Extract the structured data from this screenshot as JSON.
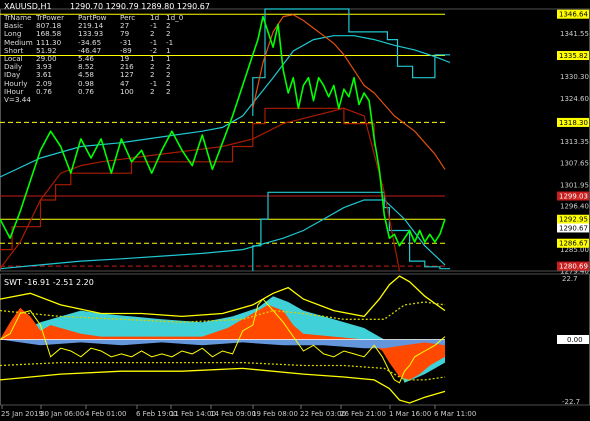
{
  "main_header": {
    "symbol": "XAUUSD,H1",
    "ohlc": "1290.70 1290.79 1289.80 1290.67"
  },
  "stats_table": {
    "columns": [
      "TrName",
      "TrPower",
      "PartPow",
      "Perc",
      "1d",
      "1d_0"
    ],
    "rows": [
      [
        "Basic",
        "807.18",
        "219.14",
        "27",
        "-1",
        "2"
      ],
      [
        "Long",
        "168.58",
        "133.93",
        "79",
        "2",
        "2"
      ],
      [
        "Medium",
        "111.30",
        "-34.65",
        "-31",
        "-1",
        "-1"
      ],
      [
        "Short",
        "51.92",
        "-46.47",
        "-89",
        "-2",
        "1"
      ],
      [
        "Local",
        "29.00",
        "5.46",
        "19",
        "1",
        "1"
      ],
      [
        "Daily",
        "3.93",
        "8.52",
        "216",
        "2",
        "2"
      ],
      [
        "IDay",
        "3.61",
        "4.58",
        "127",
        "2",
        "2"
      ],
      [
        "Hourly",
        "2.09",
        "0.98",
        "47",
        "-1",
        "2"
      ],
      [
        "IHour",
        "0.76",
        "0.76",
        "100",
        "2",
        "2"
      ]
    ],
    "footer": "V=3.44"
  },
  "colors": {
    "background": "#000000",
    "price": "#00ff00",
    "cyan": "#1fc8d2",
    "orange_line": "#e05010",
    "dark_red": "#aa1c00",
    "yellow": "#ffff00",
    "red_level": "#c81e1e",
    "swt_cyan_fill": "#40d0d8",
    "swt_orange_fill": "#ff4800",
    "swt_blue_fill": "#6496dc"
  },
  "chart_data": [
    {
      "type": "line",
      "title": "XAUUSD,H1",
      "yticks": [
        "1346.64",
        "1341.55",
        "1335.82",
        "1330.30",
        "1324.60",
        "1318.30",
        "1313.35",
        "1307.65",
        "1301.95",
        "1299.03",
        "1296.40",
        "1292.95",
        "1290.67",
        "1286.67",
        "1285.00",
        "1280.69",
        "1279.40"
      ],
      "ylim": [
        1279.4,
        1348.0
      ],
      "xticks": [
        "25 Jan 2019",
        "30 Jan 06:00",
        "4 Feb 01:00",
        "6 Feb 19:00",
        "11 Feb 14:00",
        "14 Feb 09:00",
        "19 Feb 08:00",
        "22 Feb 03:00",
        "26 Feb 21:00",
        "1 Mar 16:00",
        "6 Mar 11:00"
      ],
      "price_labels": [
        {
          "text": "1346.64",
          "value": 1346.64,
          "bg": "#ffff00",
          "fg": "#000000"
        },
        {
          "text": "1335.82",
          "value": 1335.82,
          "bg": "#ffff00",
          "fg": "#000000"
        },
        {
          "text": "1318.30",
          "value": 1318.3,
          "bg": "#ffff00",
          "fg": "#000000"
        },
        {
          "text": "1299.03",
          "value": 1299.03,
          "bg": "#c81e1e",
          "fg": "#ffffff"
        },
        {
          "text": "1292.95",
          "value": 1292.95,
          "bg": "#ffff00",
          "fg": "#000000"
        },
        {
          "text": "1290.67",
          "value": 1290.67,
          "bg": "#ffffff",
          "fg": "#000000"
        },
        {
          "text": "1286.67",
          "value": 1286.67,
          "bg": "#ffff00",
          "fg": "#000000"
        },
        {
          "text": "1280.69",
          "value": 1280.69,
          "bg": "#c81e1e",
          "fg": "#ffffff"
        }
      ],
      "horizontal_levels": [
        {
          "value": 1346.64,
          "color": "#ffff00",
          "dashed": false
        },
        {
          "value": 1335.82,
          "color": "#ffff00",
          "dashed": false
        },
        {
          "value": 1318.3,
          "color": "#ffff00",
          "dashed": true
        },
        {
          "value": 1299.03,
          "color": "#c81e1e",
          "dashed": false
        },
        {
          "value": 1292.95,
          "color": "#ffff00",
          "dashed": false
        },
        {
          "value": 1286.67,
          "color": "#ffff00",
          "dashed": true
        },
        {
          "value": 1280.69,
          "color": "#c81e1e",
          "dashed": true
        }
      ],
      "x_range": [
        0,
        440
      ],
      "series": [
        {
          "role": "price",
          "color": "#00ff00",
          "x": [
            0,
            10,
            20,
            30,
            40,
            50,
            60,
            70,
            80,
            90,
            100,
            110,
            120,
            130,
            140,
            150,
            160,
            170,
            180,
            190,
            200,
            210,
            220,
            230,
            240,
            250,
            255,
            260,
            265,
            270,
            275,
            280,
            285,
            290,
            295,
            300,
            305,
            310,
            315,
            320,
            325,
            330,
            335,
            340,
            345,
            350,
            355,
            360,
            365,
            370,
            375,
            380,
            385,
            390,
            395,
            400,
            405,
            410,
            415,
            420,
            425,
            430,
            435,
            440
          ],
          "y": [
            1293,
            1288,
            1295,
            1303,
            1311,
            1316,
            1312,
            1305,
            1314,
            1309,
            1314,
            1305,
            1314,
            1308,
            1311,
            1305,
            1311,
            1316,
            1311,
            1307,
            1315,
            1306,
            1313,
            1320,
            1328,
            1336,
            1340,
            1346,
            1342,
            1338,
            1344,
            1332,
            1326,
            1330,
            1322,
            1328,
            1330,
            1324,
            1330,
            1328,
            1325,
            1328,
            1322,
            1327,
            1325,
            1330,
            1323,
            1326,
            1324,
            1314,
            1306,
            1294,
            1288,
            1289,
            1286,
            1288,
            1290,
            1287,
            1290,
            1287,
            1289,
            1287,
            1289,
            1293
          ]
        },
        {
          "role": "cyan-envelope",
          "color": "#1fc8d2",
          "x": [
            0,
            40,
            80,
            120,
            160,
            200,
            220,
            240,
            255,
            270,
            290,
            310,
            330,
            350,
            370,
            390,
            410,
            430,
            445
          ],
          "y": [
            1304,
            1309,
            1312,
            1313,
            1314.5,
            1316,
            1317,
            1320,
            1325,
            1330,
            1337,
            1340,
            1341,
            1341,
            1340,
            1338.5,
            1337.3,
            1335.5,
            1334
          ]
        },
        {
          "role": "cyan-lower",
          "color": "#1fc8d2",
          "x": [
            0,
            40,
            80,
            120,
            160,
            200,
            240,
            280,
            300,
            320,
            340,
            360,
            380,
            400,
            420,
            440
          ],
          "y": [
            1280,
            1281,
            1282,
            1282.6,
            1283.3,
            1284,
            1285,
            1288,
            1290,
            1293,
            1296,
            1298,
            1298,
            1293,
            1286,
            1281
          ]
        },
        {
          "role": "cyan-step-upper",
          "color": "#1fc8d2",
          "x": [
            250,
            250,
            262,
            262,
            345,
            345,
            383,
            383,
            393,
            393,
            408,
            408,
            430,
            430,
            445
          ],
          "y": [
            1320,
            1330,
            1330,
            1348,
            1348,
            1342,
            1342,
            1340,
            1340,
            1333,
            1333,
            1330,
            1330,
            1336,
            1336
          ]
        },
        {
          "role": "cyan-step-lower",
          "color": "#1fc8d2",
          "x": [
            250,
            250,
            258,
            258,
            265,
            265,
            380,
            380,
            385,
            385,
            405,
            405,
            420,
            420,
            435,
            435,
            445
          ],
          "y": [
            1279.4,
            1286,
            1286,
            1293,
            1293,
            1300,
            1300,
            1296,
            1296,
            1290,
            1290,
            1282,
            1282,
            1280.5,
            1280.5,
            1280,
            1280
          ]
        },
        {
          "role": "orange-curve",
          "color": "#e05010",
          "x": [
            250,
            260,
            270,
            280,
            290,
            300,
            310,
            320,
            330,
            340,
            350,
            360,
            370,
            380,
            390,
            400,
            410,
            420,
            430,
            440
          ],
          "y": [
            1322,
            1334,
            1342,
            1346,
            1346.5,
            1345,
            1343,
            1341,
            1339,
            1336,
            1332,
            1328,
            1326,
            1323,
            1320,
            1318,
            1316,
            1313,
            1310,
            1306
          ]
        },
        {
          "role": "dark-red-step",
          "color": "#aa1c00",
          "x": [
            0,
            12,
            12,
            40,
            40,
            55,
            55,
            70,
            70,
            130,
            130,
            230,
            230,
            250,
            250,
            262,
            262,
            340,
            340,
            370,
            370
          ],
          "y": [
            1285,
            1285,
            1291,
            1291,
            1298,
            1298,
            1302,
            1302,
            1305,
            1305,
            1308,
            1308,
            1312,
            1312,
            1318,
            1318,
            1322,
            1322,
            1318,
            1318,
            1312
          ]
        },
        {
          "role": "dark-red-curve",
          "color": "#aa1c00",
          "x": [
            0,
            20,
            40,
            60,
            80,
            100,
            130,
            160,
            190,
            220,
            250,
            280,
            310,
            340,
            360,
            380,
            395
          ],
          "y": [
            1280,
            1287,
            1298,
            1305,
            1307,
            1308,
            1309,
            1310,
            1311,
            1312,
            1314,
            1318,
            1320,
            1322,
            1320,
            1300,
            1279.4
          ]
        }
      ]
    },
    {
      "type": "area",
      "title": "SWT -16.91 -2.51 2.20",
      "ylim": [
        -22.7,
        22.7
      ],
      "yticks": [
        "22.7",
        "0.00",
        "-22.7"
      ],
      "zero_label": {
        "text": "0.00",
        "bg": "#ffffff",
        "fg": "#000000"
      },
      "x_range": [
        0,
        440
      ],
      "series": [
        {
          "role": "cyan-fill",
          "color": "#40d0d8",
          "x": [
            0,
            40,
            60,
            80,
            100,
            130,
            160,
            200,
            230,
            255,
            270,
            285,
            300,
            330,
            360,
            380,
            390,
            400,
            420,
            440
          ],
          "y": [
            0,
            6,
            8,
            10,
            9,
            8,
            7,
            6,
            8,
            11,
            15,
            13,
            10,
            7,
            4,
            0,
            -6,
            -15,
            -12,
            -8
          ]
        },
        {
          "role": "orange-fill",
          "color": "#ff4800",
          "x": [
            0,
            10,
            20,
            30,
            40,
            50,
            60,
            80,
            100,
            130,
            160,
            200,
            225,
            245,
            265,
            280,
            290,
            300,
            330,
            360,
            378,
            385,
            395,
            405,
            415,
            425,
            440
          ],
          "y": [
            0,
            6,
            11,
            8,
            3,
            5,
            4,
            2,
            1,
            1,
            1,
            1,
            4,
            8,
            12,
            10,
            5,
            2,
            1,
            0,
            -4,
            -8,
            -13,
            -14,
            -12,
            -9,
            -6
          ]
        },
        {
          "role": "blue-fill",
          "color": "#6496dc",
          "x": [
            0,
            40,
            80,
            120,
            160,
            200,
            240,
            280,
            320,
            360,
            380,
            400,
            420,
            440
          ],
          "y": [
            0,
            -2,
            -1,
            -2,
            -1,
            -2,
            -1,
            -2,
            -2,
            -3,
            -3,
            -2,
            -1,
            -2
          ]
        },
        {
          "role": "yellow-upper",
          "color": "#ffff00",
          "x": [
            0,
            30,
            60,
            100,
            140,
            180,
            220,
            250,
            270,
            285,
            300,
            330,
            360,
            375,
            385,
            395,
            405,
            420,
            440
          ],
          "y": [
            14,
            16,
            12,
            9,
            9,
            8,
            9,
            12,
            16,
            18,
            14,
            10,
            8,
            14,
            19,
            22,
            20,
            15,
            10
          ]
        },
        {
          "role": "yellow-lower",
          "color": "#ffff00",
          "x": [
            0,
            60,
            120,
            180,
            240,
            300,
            340,
            370,
            385,
            395,
            405,
            420,
            440
          ],
          "y": [
            -14,
            -12,
            -11,
            -11,
            -10,
            -12,
            -13,
            -14,
            -17,
            -21,
            -22,
            -20,
            -18
          ]
        },
        {
          "role": "yellow-line",
          "color": "#ffff00",
          "x": [
            0,
            10,
            20,
            30,
            40,
            50,
            60,
            70,
            80,
            90,
            100,
            110,
            120,
            130,
            140,
            150,
            160,
            170,
            180,
            190,
            200,
            210,
            220,
            230,
            240,
            250,
            255,
            260,
            270,
            280,
            290,
            300,
            310,
            320,
            330,
            340,
            350,
            360,
            370,
            378,
            385,
            390,
            395,
            400,
            405,
            410,
            420,
            430,
            440
          ],
          "y": [
            0,
            2,
            9,
            10,
            5,
            -6,
            -3,
            -4,
            -6,
            -3,
            -4,
            -6,
            -5,
            -6,
            -4,
            -6,
            -5,
            -6,
            -4,
            -5,
            -3,
            -6,
            -4,
            -5,
            3,
            5,
            12,
            14,
            10,
            6,
            1,
            -4,
            -2,
            -5,
            -6,
            -4,
            -5,
            -6,
            -2,
            -6,
            -11,
            -14,
            -15,
            -11,
            -9,
            -6,
            -4,
            -2,
            1
          ]
        },
        {
          "role": "yellow-dotted-upper",
          "color": "#d2d200",
          "x": [
            0,
            60,
            120,
            180,
            240,
            270,
            300,
            340,
            380,
            400,
            420,
            440
          ],
          "y": [
            10,
            8,
            7,
            6,
            7,
            10,
            9,
            7,
            7,
            12,
            13,
            12
          ]
        },
        {
          "role": "yellow-dotted-lower",
          "color": "#d2d200",
          "x": [
            0,
            60,
            120,
            180,
            240,
            300,
            340,
            380,
            400,
            420,
            440
          ],
          "y": [
            -9,
            -8,
            -8,
            -8,
            -8,
            -9,
            -9,
            -10,
            -14,
            -14,
            -13
          ]
        }
      ]
    }
  ]
}
